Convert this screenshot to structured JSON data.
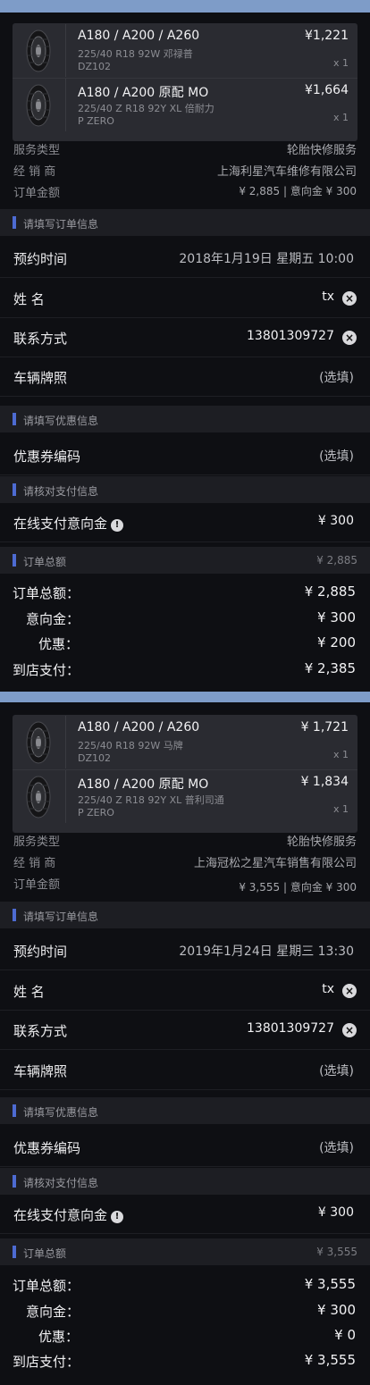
{
  "orders": [
    {
      "products": [
        {
          "model": "A180 / A200 / A260",
          "spec": "225/40 R18 92W 邓禄普",
          "pattern": "DZ102",
          "price": "¥1,221",
          "qty": "x 1"
        },
        {
          "model": "A180 / A200 原配 MO",
          "spec": "225/40 Z R18 92Y XL 倍耐力",
          "pattern": "P ZERO",
          "price": "¥1,664",
          "qty": "x 1"
        }
      ],
      "info": {
        "service_type_label": "服务类型",
        "service_type": "轮胎快修服务",
        "dealer_label": "经 销 商",
        "dealer": "上海利星汽车维修有限公司",
        "amount_label": "订单金额",
        "amount": "¥ 2,885 | 意向金 ¥ 300"
      },
      "order_section": "请填写订单信息",
      "appointment_label": "预约时间",
      "appointment": "2018年1月19日   星期五   10:00",
      "name_label": "姓      名",
      "name": "tx",
      "contact_label": "联系方式",
      "contact": "13801309727",
      "plate_label": "车辆牌照",
      "plate": "(选填)",
      "coupon_section": "请填写优惠信息",
      "coupon_label": "优惠券编码",
      "coupon": "(选填)",
      "pay_section": "请核对支付信息",
      "online_label": "在线支付意向金",
      "online": "¥ 300",
      "total_section": "订单总额",
      "total_section_value": "¥ 2,885",
      "summary": {
        "total_label": "订单总额：",
        "total": "¥ 2,885",
        "deposit_label": "意向金：",
        "deposit": "¥ 300",
        "discount_label": "优惠：",
        "discount": "¥ 200",
        "instore_label": "到店支付：",
        "instore": "¥ 2,385"
      }
    },
    {
      "products": [
        {
          "model": "A180 / A200 / A260",
          "spec": "225/40 R18 92W   马牌",
          "pattern": "DZ102",
          "price": "¥ 1,721",
          "qty": "x 1"
        },
        {
          "model": "A180 / A200 原配 MO",
          "spec": "225/40 Z R18 92Y XL   普利司通",
          "pattern": "P ZERO",
          "price": "¥ 1,834",
          "qty": "x 1"
        }
      ],
      "info": {
        "service_type_label": "服务类型",
        "service_type": "轮胎快修服务",
        "dealer_label": "经 销 商",
        "dealer": "上海冠松之星汽车销售有限公司",
        "amount_label": "订单金额",
        "amount": "¥ 3,555  |  意向金 ¥ 300"
      },
      "order_section": "请填写订单信息",
      "appointment_label": "预约时间",
      "appointment": "2019年1月24日   星期三   13:30",
      "name_label": "姓      名",
      "name": "tx",
      "contact_label": "联系方式",
      "contact": "13801309727",
      "plate_label": "车辆牌照",
      "plate": "(选填)",
      "coupon_section": "请填写优惠信息",
      "coupon_label": "优惠券编码",
      "coupon": "(选填)",
      "pay_section": "请核对支付信息",
      "online_label": "在线支付意向金",
      "online": "¥ 300",
      "total_section": "订单总额",
      "total_section_value": "¥ 3,555",
      "summary": {
        "total_label": "订单总额：",
        "total": "¥ 3,555",
        "deposit_label": "意向金：",
        "deposit": "¥ 300",
        "discount_label": "优惠：",
        "discount": "¥ 0",
        "instore_label": "到店支付：",
        "instore": "¥ 3,555"
      }
    }
  ],
  "icons": {
    "clear": "close-circle-icon",
    "info": "info-circle-icon",
    "tire": "tire-icon"
  },
  "colors": {
    "accent": "#4d6bd2",
    "banner": "#7e9cc8",
    "background": "#0e0f13",
    "card": "#2a2b31"
  }
}
